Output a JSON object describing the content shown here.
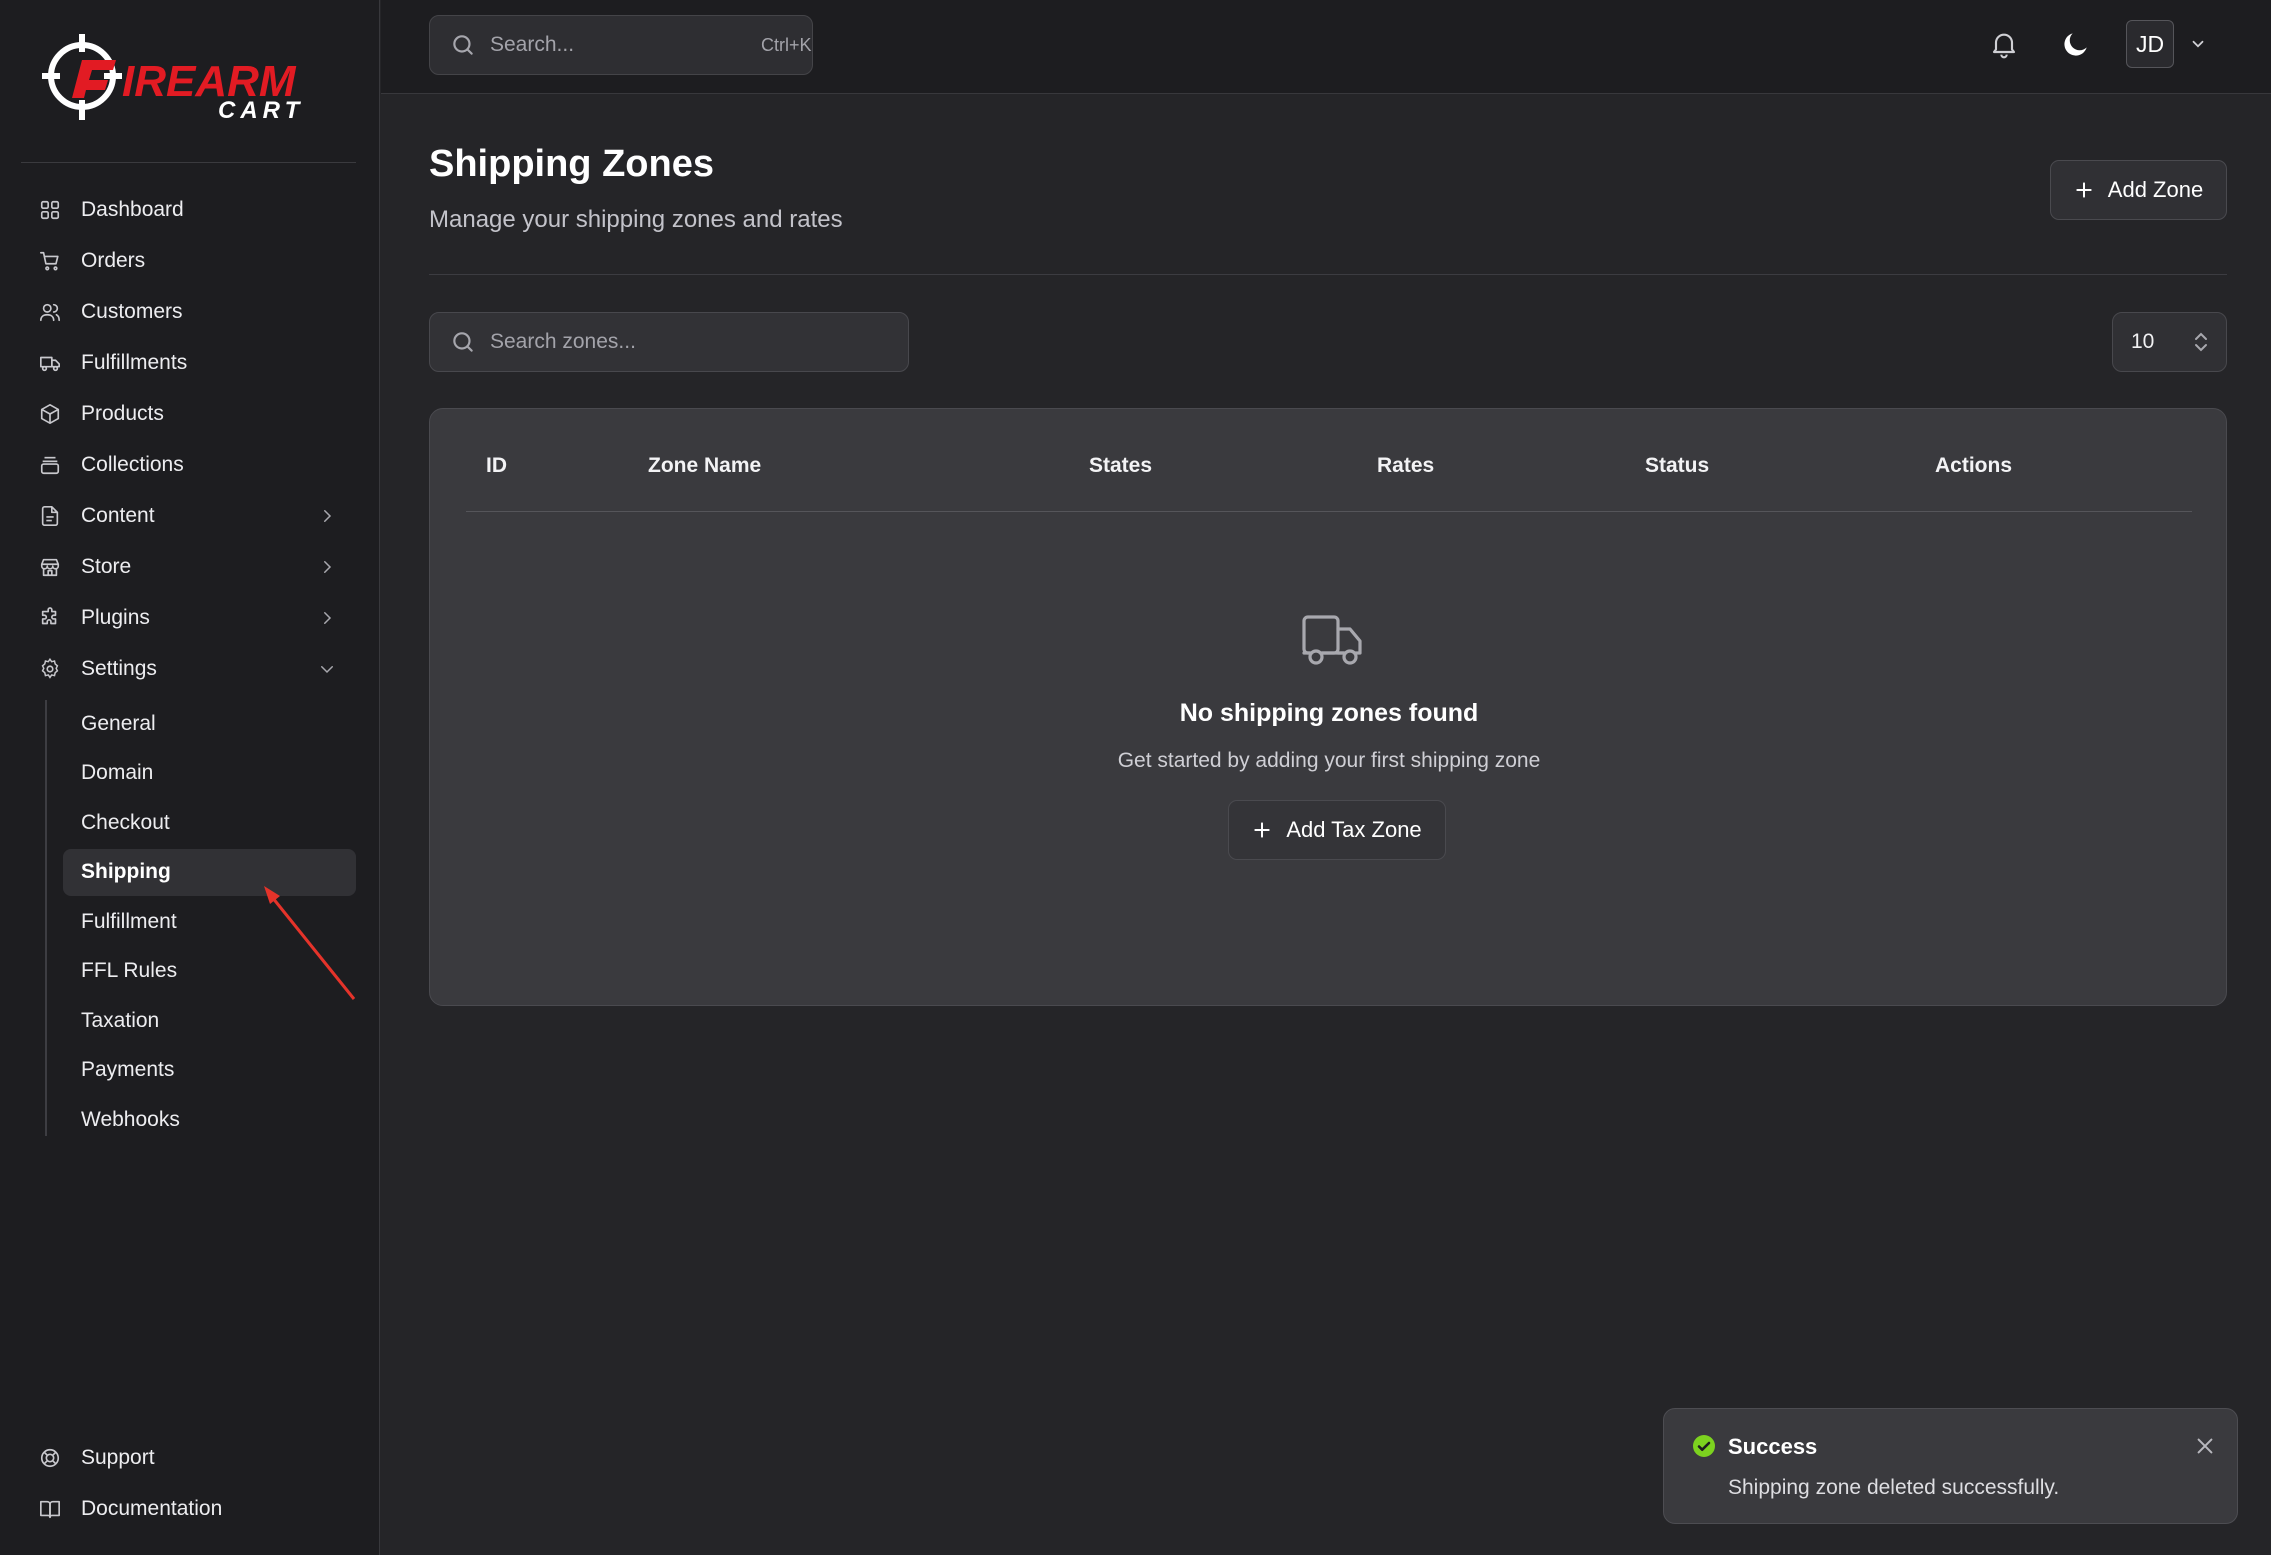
{
  "brand": {
    "name_top": "FIREARM",
    "name_bottom": "CART",
    "accent": "#e21b23"
  },
  "sidebar": {
    "items": [
      {
        "label": "Dashboard",
        "icon": "dashboard-icon"
      },
      {
        "label": "Orders",
        "icon": "cart-icon"
      },
      {
        "label": "Customers",
        "icon": "users-icon"
      },
      {
        "label": "Fulfillments",
        "icon": "truck-icon"
      },
      {
        "label": "Products",
        "icon": "box-icon"
      },
      {
        "label": "Collections",
        "icon": "archive-icon"
      },
      {
        "label": "Content",
        "icon": "document-icon",
        "expandable": true
      },
      {
        "label": "Store",
        "icon": "store-icon",
        "expandable": true
      },
      {
        "label": "Plugins",
        "icon": "puzzle-icon",
        "expandable": true
      },
      {
        "label": "Settings",
        "icon": "gear-icon",
        "expanded": true
      }
    ],
    "settings_sub": [
      "General",
      "Domain",
      "Checkout",
      "Shipping",
      "Fulfillment",
      "FFL Rules",
      "Taxation",
      "Payments",
      "Webhooks"
    ],
    "active_sub": "Shipping",
    "bottom": [
      {
        "label": "Support",
        "icon": "lifebuoy-icon"
      },
      {
        "label": "Documentation",
        "icon": "book-icon"
      }
    ]
  },
  "topbar": {
    "search_placeholder": "Search...",
    "shortcut": "Ctrl+K",
    "avatar_initials": "JD"
  },
  "page": {
    "title": "Shipping Zones",
    "subtitle": "Manage your shipping zones and rates",
    "add_button": "Add Zone",
    "search_placeholder": "Search zones...",
    "page_size": "10"
  },
  "table": {
    "columns": [
      "ID",
      "Zone Name",
      "States",
      "Rates",
      "Status",
      "Actions"
    ],
    "rows": [],
    "empty_title": "No shipping zones found",
    "empty_subtitle": "Get started by adding your first shipping zone",
    "empty_button": "Add Tax Zone"
  },
  "toast": {
    "title": "Success",
    "message": "Shipping zone deleted successfully.",
    "color": "#7cd21f"
  },
  "annotation": {
    "color": "#e5332a"
  }
}
